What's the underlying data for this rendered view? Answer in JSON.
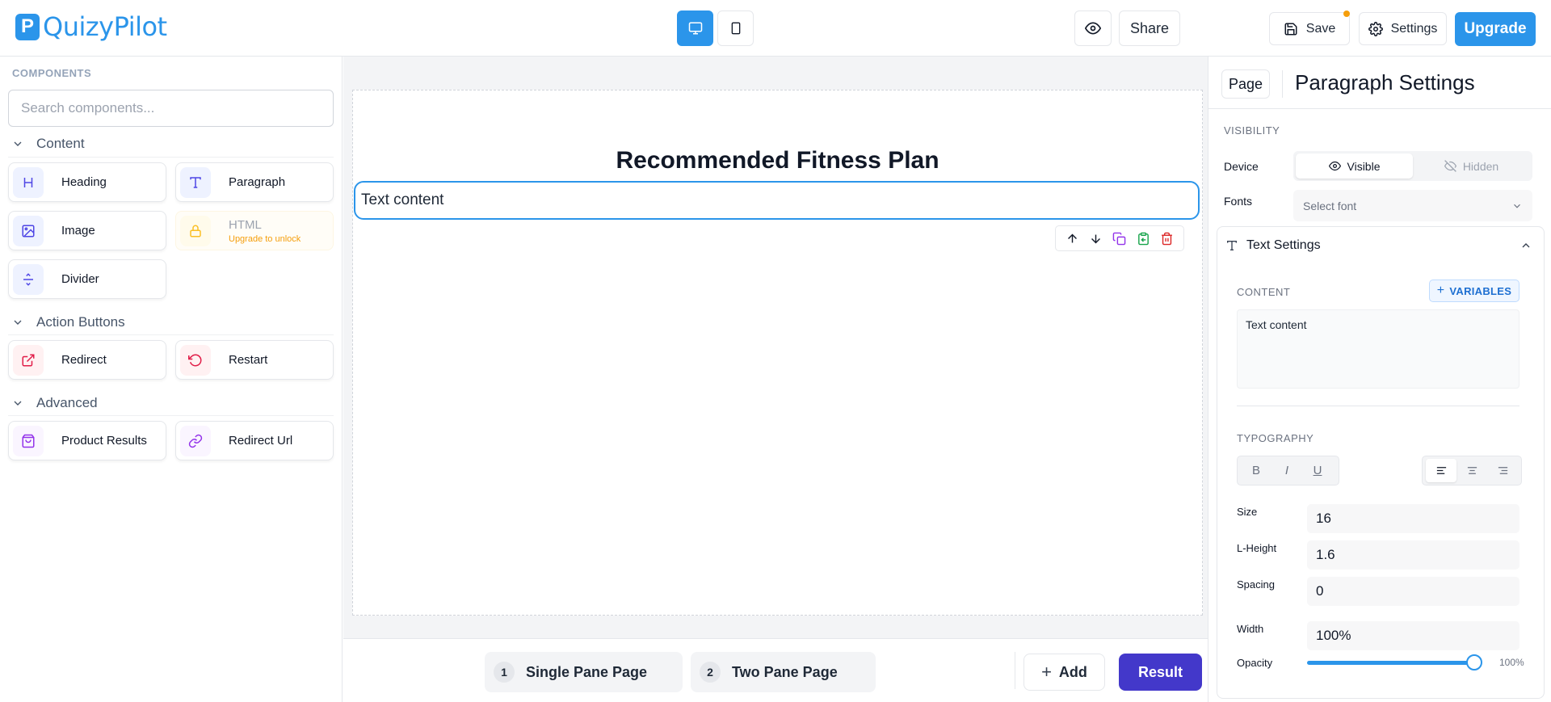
{
  "app": {
    "brand_letter": "P",
    "brand_name": "QuizyPilot"
  },
  "toolbar": {
    "save": "Save",
    "settings": "Settings",
    "upgrade": "Upgrade",
    "share": "Share"
  },
  "sidebar": {
    "heading": "COMPONENTS",
    "search_placeholder": "Search components...",
    "sections": [
      {
        "title": "Content",
        "items": [
          {
            "label": "Heading",
            "icon": "heading-icon"
          },
          {
            "label": "Paragraph",
            "icon": "text-icon"
          },
          {
            "label": "Image",
            "icon": "image-icon"
          },
          {
            "label": "HTML",
            "icon": "lock-icon",
            "note": "Upgrade to unlock"
          },
          {
            "label": "Divider",
            "icon": "divider-icon"
          }
        ]
      },
      {
        "title": "Action Buttons",
        "items": [
          {
            "label": "Redirect",
            "icon": "external-link-icon"
          },
          {
            "label": "Restart",
            "icon": "restart-icon"
          }
        ]
      },
      {
        "title": "Advanced",
        "items": [
          {
            "label": "Product Results",
            "icon": "shopping-bag-icon"
          },
          {
            "label": "Redirect Url",
            "icon": "link-icon"
          }
        ]
      }
    ]
  },
  "canvas": {
    "heading": "Recommended Fitness Plan",
    "paragraph": "Text content"
  },
  "pages": {
    "items": [
      {
        "number": "1",
        "label": "Single Pane Page"
      },
      {
        "number": "2",
        "label": "Two Pane Page"
      }
    ],
    "add": "Add",
    "result": "Result"
  },
  "settings": {
    "page_button": "Page",
    "title": "Paragraph Settings",
    "visibility_heading": "VISIBILITY",
    "device_label": "Device",
    "visible": "Visible",
    "hidden": "Hidden",
    "fonts_label": "Fonts",
    "font_placeholder": "Select font",
    "text_settings": "Text Settings",
    "content_heading": "CONTENT",
    "variables": "VARIABLES",
    "content_value": "Text content",
    "typography_heading": "TYPOGRAPHY",
    "format_buttons": [
      "B",
      "I",
      "U"
    ],
    "size_label": "Size",
    "size_value": "16",
    "lheight_label": "L-Height",
    "lheight_value": "1.6",
    "spacing_label": "Spacing",
    "spacing_value": "0",
    "width_label": "Width",
    "width_value": "100%",
    "opacity_label": "Opacity",
    "opacity_value": "100%",
    "opacity_level": 1.0
  },
  "colors": {
    "accent": "#2b95ea",
    "result": "#4338ca",
    "delete": "#dc2626",
    "copy": "#9333ea",
    "paste": "#16a34a",
    "unsaved_dot": "#f59e0b"
  }
}
